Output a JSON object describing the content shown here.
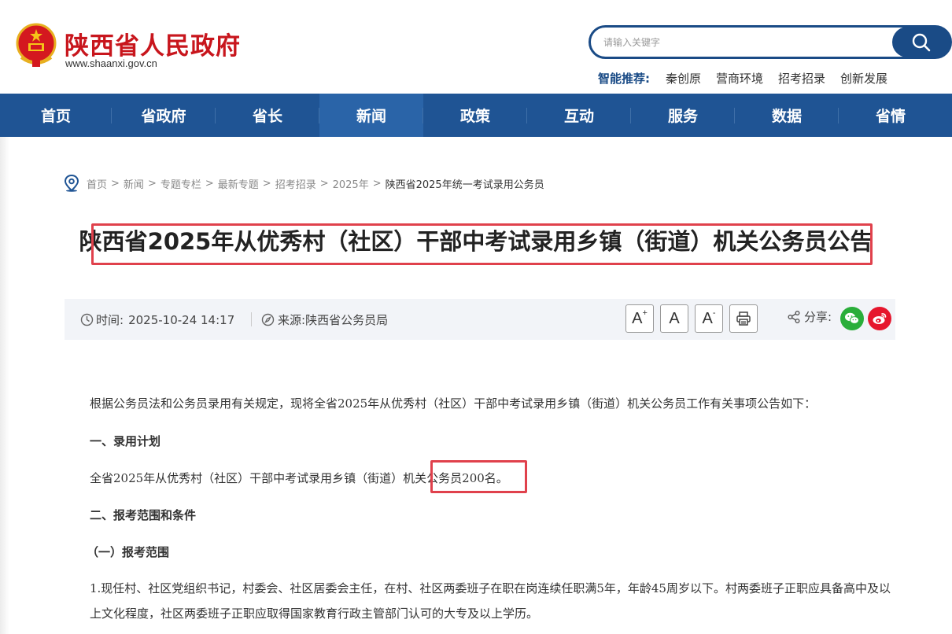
{
  "header": {
    "site_title": "陕西省人民政府",
    "site_domain": "www.shaanxi.gov.cn",
    "search_placeholder": "请输入关键字",
    "smart_label": "智能推荐:",
    "smart_links": [
      "秦创原",
      "营商环境",
      "招考招录",
      "创新发展"
    ]
  },
  "nav": {
    "items": [
      "首页",
      "省政府",
      "省长",
      "新闻",
      "政策",
      "互动",
      "服务",
      "数据",
      "省情"
    ],
    "active": "新闻"
  },
  "breadcrumb": [
    "首页",
    "新闻",
    "专题专栏",
    "最新专题",
    "招考招录",
    "2025年",
    "陕西省2025年统一考试录用公务员"
  ],
  "breadcrumb_separator": ">",
  "article": {
    "title": "陕西省2025年从优秀村（社区）干部中考试录用乡镇（街道）机关公务员公告",
    "time_label": "时间:",
    "time_value": "2025-10-24 14:17",
    "source_label": "来源:",
    "source_value": "陕西省公务员局",
    "font_large": "A",
    "font_large_sup": "+",
    "font_normal": "A",
    "font_small": "A",
    "font_small_sup": "-",
    "share_label": "分享:",
    "paragraphs": {
      "intro": "根据公务员法和公务员录用有关规定，现将全省2025年从优秀村（社区）干部中考试录用乡镇（街道）机关公务员工作有关事项公告如下：",
      "section1": "一、录用计划",
      "plan": "全省2025年从优秀村（社区）干部中考试录用乡镇（街道）机关公务员200名。",
      "section2": "二、报考范围和条件",
      "subsection1": "（一）报考范围",
      "item1": "1.现任村、社区党组织书记，村委会、社区居委会主任，在村、社区两委班子在职在岗连续任职满5年，年龄45周岁以下。村两委班子正职应具备高中及以上文化程度，社区两委班子正职应取得国家教育行政主管部门认可的大专及以上学历。"
    }
  },
  "colors": {
    "brand_red": "#c8161d",
    "nav_blue": "#1f5494",
    "highlight_red": "#e0414c",
    "wechat_green": "#2aae3a",
    "weibo_red": "#e6162d"
  }
}
